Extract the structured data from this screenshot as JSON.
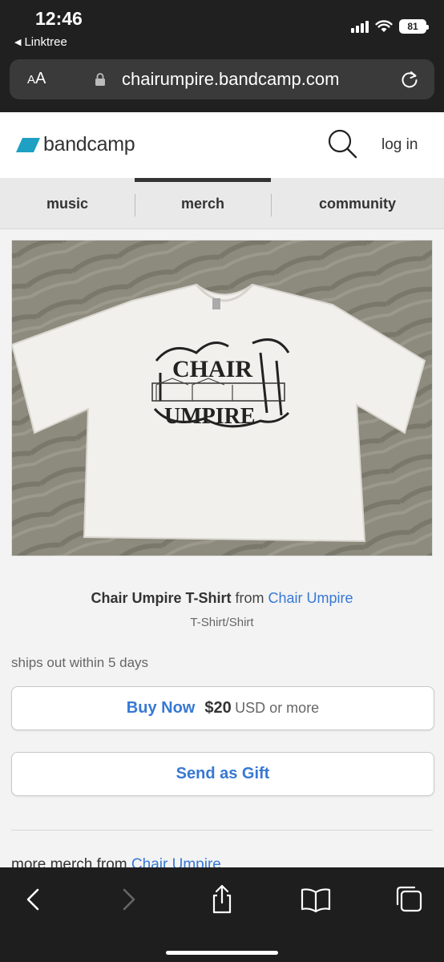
{
  "status_bar": {
    "time": "12:46",
    "back_app": "Linktree",
    "battery": "81"
  },
  "browser": {
    "aa_label_small": "A",
    "aa_label_large": "A",
    "url": "chairumpire.bandcamp.com"
  },
  "site_header": {
    "logo_text": "bandcamp",
    "login_label": "log in"
  },
  "nav": {
    "tabs": [
      {
        "label": "music"
      },
      {
        "label": "merch",
        "active": true
      },
      {
        "label": "community"
      }
    ]
  },
  "product": {
    "title": "Chair Umpire T-Shirt",
    "from_label": "from",
    "artist": "Chair Umpire",
    "type": "T-Shirt/Shirt",
    "image_print_text_1": "CHAIR",
    "image_print_text_2": "UMPIRE",
    "shipping": "ships out within 5 days",
    "buy_label": "Buy Now",
    "price": "$20",
    "currency_text": "USD or more",
    "gift_label": "Send as Gift"
  },
  "more_merch": {
    "prefix": "more merch from",
    "artist": "Chair Umpire"
  },
  "colors": {
    "link_blue": "#3778d4",
    "chrome_dark": "#202020",
    "bandcamp_logo": "#1da0c3"
  },
  "icons": [
    "lock-icon",
    "reload-icon",
    "search-icon",
    "back-icon",
    "forward-icon",
    "share-icon",
    "bookmarks-icon",
    "tabs-icon"
  ]
}
